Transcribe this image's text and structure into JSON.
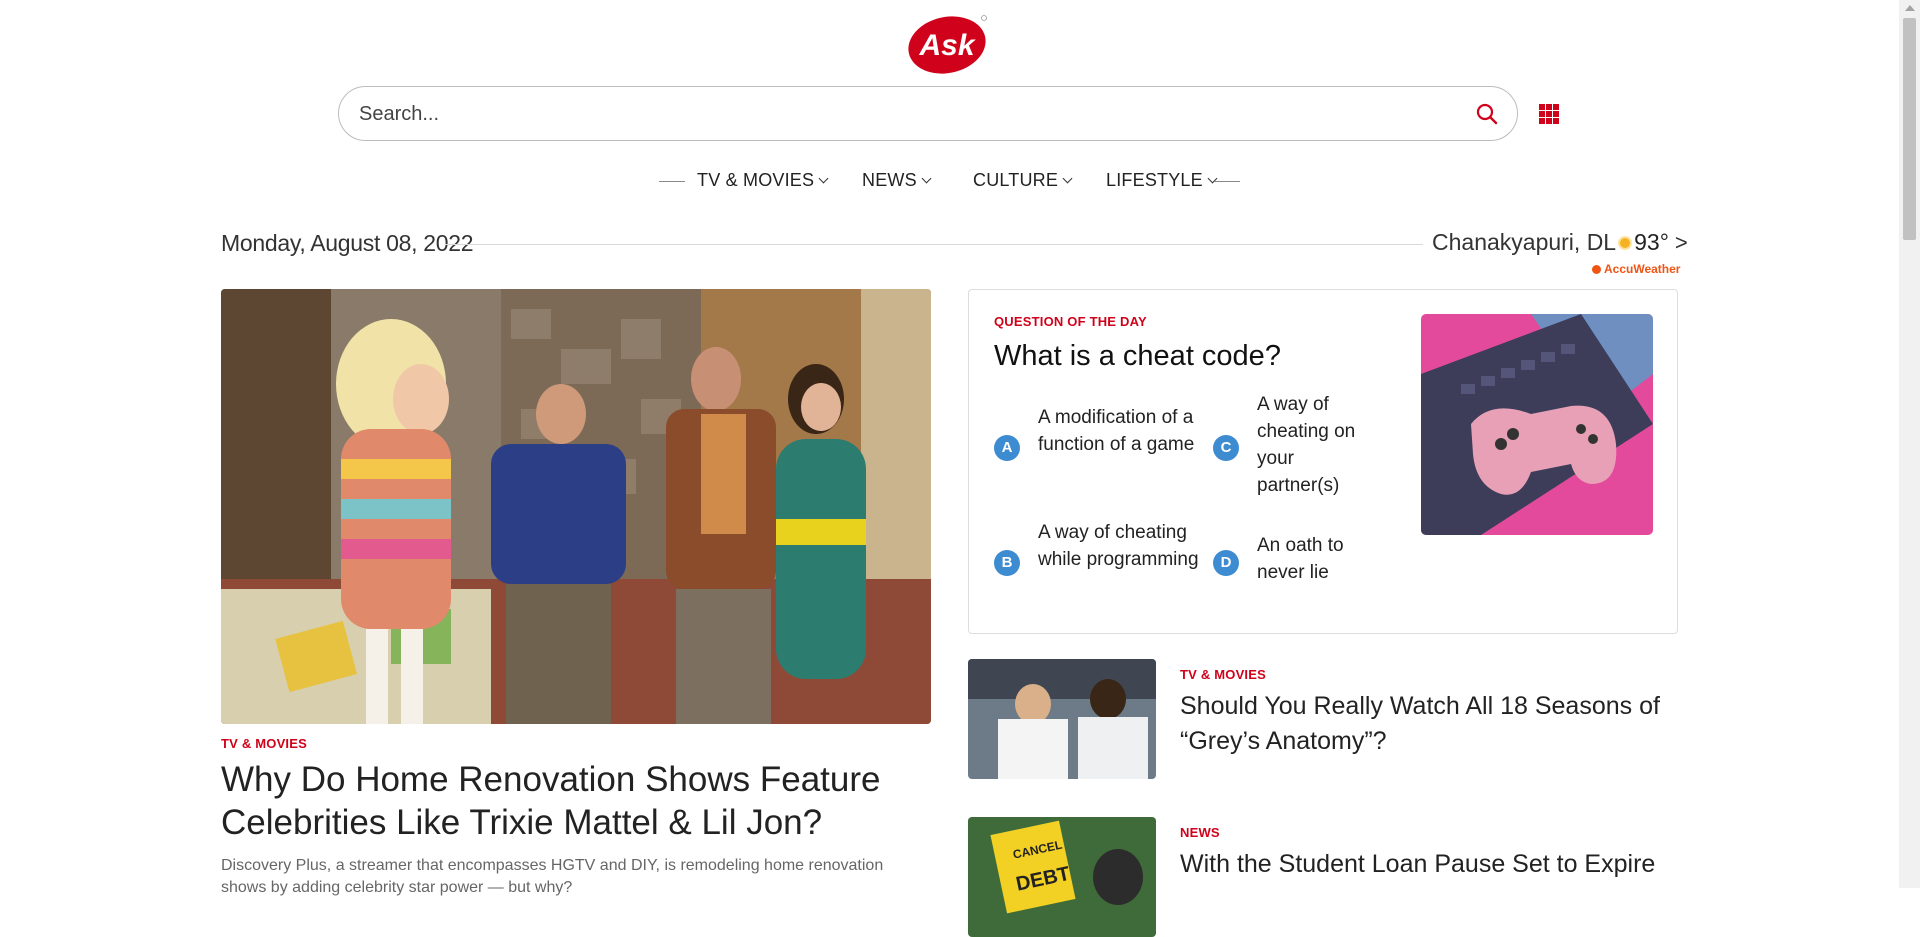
{
  "brand": {
    "logo_text": "Ask",
    "accent": "#d0021b"
  },
  "search": {
    "placeholder": "Search..."
  },
  "nav": {
    "items": [
      {
        "label": "TV & MOVIES"
      },
      {
        "label": "NEWS"
      },
      {
        "label": "CULTURE"
      },
      {
        "label": "LIFESTYLE"
      }
    ]
  },
  "date": "Monday, August 08, 2022",
  "weather": {
    "location": "Chanakyapuri, DL",
    "temp": "93°",
    "more": ">",
    "provider": "AccuWeather"
  },
  "hero": {
    "category": "TV & MOVIES",
    "title": "Why Do Home Renovation Shows Feature Celebrities Like Trixie Mattel & Lil Jon?",
    "description": "Discovery Plus, a streamer that encompasses HGTV and DIY, is remodeling home renovation shows by adding celebrity star power — but why?"
  },
  "qotd": {
    "label": "QUESTION OF THE DAY",
    "question": "What is a cheat code?",
    "answers": [
      {
        "letter": "A",
        "text": "A modification of a function of a game"
      },
      {
        "letter": "B",
        "text": "A way of cheating while programming"
      },
      {
        "letter": "C",
        "text": "A way of cheating on your partner(s)"
      },
      {
        "letter": "D",
        "text": "An oath to never lie"
      }
    ]
  },
  "articles": [
    {
      "category": "TV & MOVIES",
      "title": "Should You Really Watch All 18 Seasons of “Grey’s Anatomy”?"
    },
    {
      "category": "NEWS",
      "title": "With the Student Loan Pause Set to Expire"
    }
  ],
  "icons": {
    "search": "search-icon",
    "apps": "apps-grid-icon",
    "weather": "sun-icon"
  }
}
